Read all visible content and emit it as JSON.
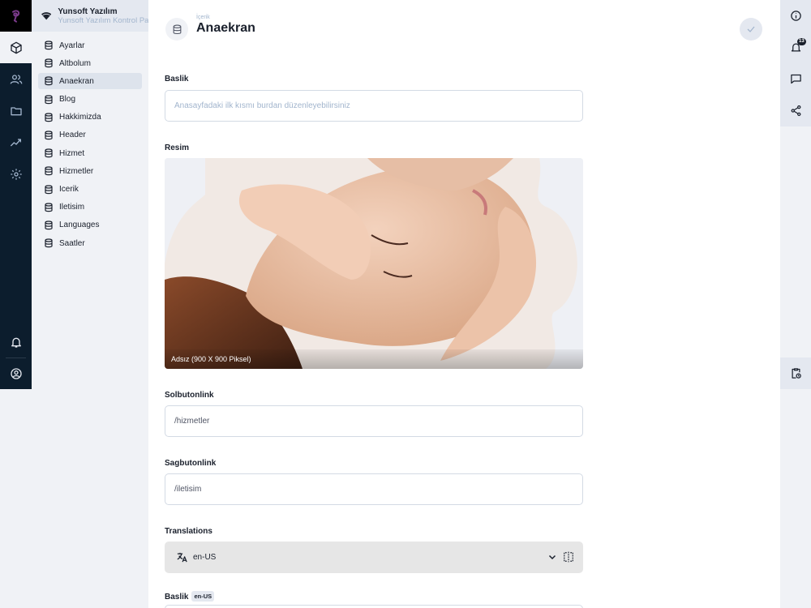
{
  "project": {
    "title": "Yunsoft Yazılım",
    "subtitle": "Yunsoft Yazılım Kontrol Paneli"
  },
  "rail": {
    "icons": [
      "box-icon",
      "users-icon",
      "folder-icon",
      "insights-icon",
      "settings-icon",
      "bell-icon",
      "account-icon"
    ],
    "active": "box-icon"
  },
  "collections": {
    "items": [
      "Ayarlar",
      "Altbolum",
      "Anaekran",
      "Blog",
      "Hakkimizda",
      "Header",
      "Hizmet",
      "Hizmetler",
      "Icerik",
      "Iletisim",
      "Languages",
      "Saatler"
    ],
    "active_index": 2
  },
  "header": {
    "breadcrumb": "İçerik",
    "title": "Anaekran"
  },
  "form": {
    "baslik": {
      "label": "Baslik",
      "placeholder": "Anasayfadaki ilk kısmı burdan düzenleyebilirsiniz"
    },
    "resim": {
      "label": "Resim",
      "caption": "Adsız (900 X 900 Piksel)"
    },
    "solbutonlink": {
      "label": "Solbutonlink",
      "value": "/hizmetler"
    },
    "sagbutonlink": {
      "label": "Sagbutonlink",
      "value": "/iletisim"
    },
    "translations": {
      "label": "Translations",
      "language": "en-US"
    },
    "baslik_translated": {
      "label": "Baslik",
      "badge": "en-US"
    }
  },
  "right_sidebar": {
    "notification_count": "13"
  },
  "colors": {
    "rail_bg": "#0c1d2d",
    "page_bg": "#f0f2f6",
    "text": "#1a202c",
    "muted": "#a2b5cd"
  }
}
